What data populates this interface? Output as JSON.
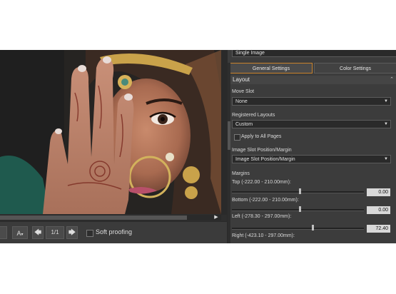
{
  "toolbar": {
    "page_indicator": "1/1",
    "soft_proofing_label": "Soft proofing",
    "view_button_label": "A"
  },
  "panel": {
    "top_dropdown": "Single Image",
    "tabs": [
      {
        "label": "General Settings",
        "active": true
      },
      {
        "label": "Color Settings",
        "active": false
      }
    ],
    "section_title": "Layout",
    "move_slot": {
      "label": "Move Slot",
      "value": "None"
    },
    "registered_layouts": {
      "label": "Registered Layouts",
      "value": "Custom"
    },
    "apply_all": {
      "label": "Apply to All Pages",
      "checked": false
    },
    "image_slot": {
      "label": "Image Slot Position/Margin",
      "value": "Image Slot Position/Margin"
    },
    "margins": {
      "label": "Margins",
      "top": {
        "label": "Top (-222.00 - 210.00mm):",
        "value": "0.00"
      },
      "bottom": {
        "label": "Bottom (-222.00 - 210.00mm):",
        "value": "0.00"
      },
      "left": {
        "label": "Left (-278.30 - 297.00mm):",
        "value": "72.40"
      },
      "right": {
        "label": "Right (-423.10 - 297.00mm):"
      }
    }
  },
  "colors": {
    "active_tab_border": "#c9822b",
    "panel_bg": "#3c3c3c"
  }
}
